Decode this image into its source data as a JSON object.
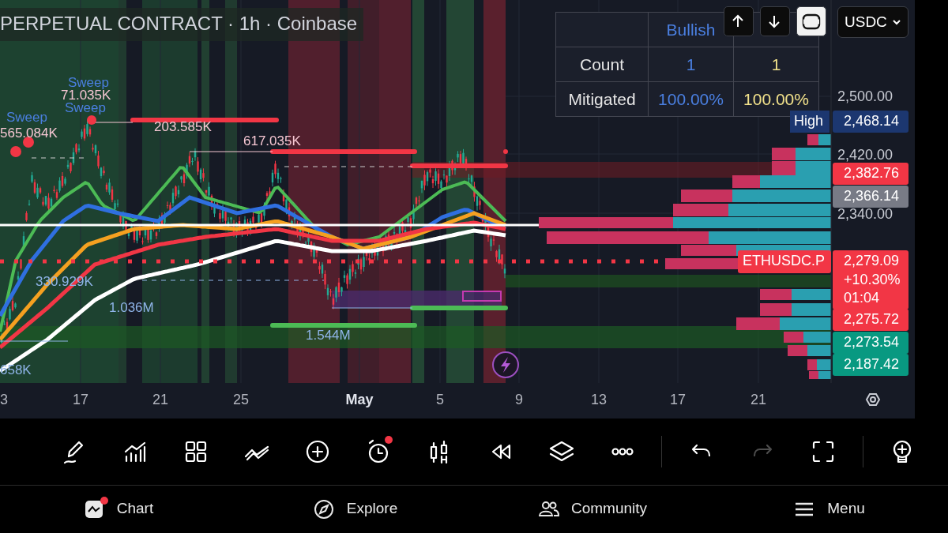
{
  "header": {
    "title": "PERPETUAL CONTRACT · 1h · Coinbase"
  },
  "stats_table": {
    "columns": [
      {
        "header": "Bullish",
        "color": "#4a7fe0"
      },
      {
        "color": "#f0e08a"
      }
    ],
    "rows": [
      {
        "label": "Count",
        "cells": [
          "1",
          "1"
        ]
      },
      {
        "label": "Mitigated",
        "cells": [
          "100.00%",
          "100.00%"
        ]
      }
    ]
  },
  "chart_buttons": [
    {
      "kind": "up",
      "selected": false
    },
    {
      "kind": "down",
      "selected": false
    },
    {
      "kind": "frame",
      "selected": true
    }
  ],
  "currency_select": {
    "value": "USDC"
  },
  "chart_labels": [
    {
      "text": "Sweep",
      "color": "#4a7fe0"
    },
    {
      "text": "71.035K",
      "color": "#f5c6d2"
    },
    {
      "text": "Sweep",
      "color": "#4a7fe0"
    },
    {
      "text": "Sweep",
      "color": "#4a7fe0"
    },
    {
      "text": "565.084K",
      "color": "#f5c6d2"
    },
    {
      "text": "203.585K",
      "color": "#f5c6d2"
    },
    {
      "text": "617.035K",
      "color": "#f5c6d2"
    },
    {
      "text": "330.929K",
      "color": "#8fb4e8"
    },
    {
      "text": "1.036M",
      "color": "#8fb4e8"
    },
    {
      "text": "1.544M",
      "color": "#8fb4e8"
    },
    {
      "text": "658K",
      "color": "#8fb4e8"
    }
  ],
  "price_axis": {
    "ticks": [
      "2,500.00",
      "2,420.00",
      "2,340.00"
    ],
    "tags": [
      {
        "label": "High",
        "value": "2,468.14",
        "color": "#1c3770"
      },
      {
        "value": "2,382.76",
        "color": "#f23645"
      },
      {
        "value": "2,366.14",
        "color": "#787b86"
      },
      {
        "value": "2,279.09",
        "lines": [
          "+10.30%",
          "01:04"
        ],
        "color": "#f23645"
      },
      {
        "value": "2,275.72",
        "color": "#f23645"
      },
      {
        "value": "2,273.54",
        "color": "#089981"
      },
      {
        "value": "2,187.42",
        "color": "#089981"
      }
    ]
  },
  "symbol_tag": {
    "text": "ETHUSDC.P",
    "color": "#f23645"
  },
  "time_axis": [
    {
      "label": "3",
      "bold": false
    },
    {
      "label": "17",
      "bold": false
    },
    {
      "label": "21",
      "bold": false
    },
    {
      "label": "25",
      "bold": false
    },
    {
      "label": "May",
      "bold": true
    },
    {
      "label": "5",
      "bold": false
    },
    {
      "label": "9",
      "bold": false
    },
    {
      "label": "13",
      "bold": false
    },
    {
      "label": "17",
      "bold": false
    },
    {
      "label": "21",
      "bold": false
    }
  ],
  "toolbar": [
    {
      "kind": "draw",
      "disabled": false
    },
    {
      "kind": "indicators",
      "disabled": false
    },
    {
      "kind": "layout",
      "disabled": false
    },
    {
      "kind": "compare",
      "disabled": false
    },
    {
      "kind": "add",
      "disabled": false
    },
    {
      "kind": "alert",
      "disabled": false,
      "badge": true
    },
    {
      "kind": "candles",
      "disabled": false
    },
    {
      "kind": "replay",
      "disabled": false
    },
    {
      "kind": "layers",
      "disabled": false
    },
    {
      "kind": "more",
      "disabled": false
    },
    {
      "kind": "divider"
    },
    {
      "kind": "undo",
      "disabled": false
    },
    {
      "kind": "redo",
      "disabled": true
    },
    {
      "kind": "fullscreen",
      "disabled": false
    },
    {
      "kind": "divider"
    },
    {
      "kind": "idea",
      "disabled": false
    }
  ],
  "bottom_nav": [
    {
      "kind": "chart",
      "label": "Chart",
      "badge": true
    },
    {
      "kind": "explore",
      "label": "Explore",
      "badge": false
    },
    {
      "kind": "community",
      "label": "Community",
      "badge": false
    },
    {
      "kind": "menu",
      "label": "Menu",
      "badge": false
    }
  ]
}
